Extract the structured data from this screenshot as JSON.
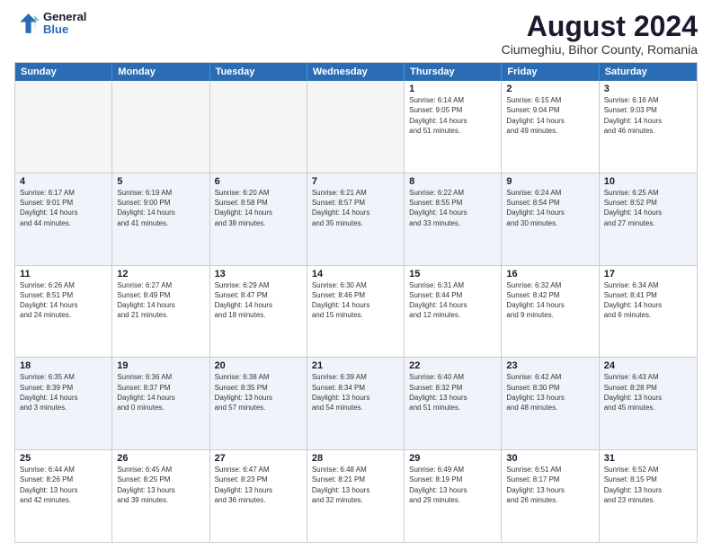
{
  "header": {
    "logo_line1": "General",
    "logo_line2": "Blue",
    "main_title": "August 2024",
    "subtitle": "Ciumeghiu, Bihor County, Romania"
  },
  "weekdays": [
    "Sunday",
    "Monday",
    "Tuesday",
    "Wednesday",
    "Thursday",
    "Friday",
    "Saturday"
  ],
  "rows": [
    [
      {
        "day": "",
        "info": "",
        "empty": true
      },
      {
        "day": "",
        "info": "",
        "empty": true
      },
      {
        "day": "",
        "info": "",
        "empty": true
      },
      {
        "day": "",
        "info": "",
        "empty": true
      },
      {
        "day": "1",
        "info": "Sunrise: 6:14 AM\nSunset: 9:05 PM\nDaylight: 14 hours\nand 51 minutes."
      },
      {
        "day": "2",
        "info": "Sunrise: 6:15 AM\nSunset: 9:04 PM\nDaylight: 14 hours\nand 49 minutes."
      },
      {
        "day": "3",
        "info": "Sunrise: 6:16 AM\nSunset: 9:03 PM\nDaylight: 14 hours\nand 46 minutes."
      }
    ],
    [
      {
        "day": "4",
        "info": "Sunrise: 6:17 AM\nSunset: 9:01 PM\nDaylight: 14 hours\nand 44 minutes."
      },
      {
        "day": "5",
        "info": "Sunrise: 6:19 AM\nSunset: 9:00 PM\nDaylight: 14 hours\nand 41 minutes."
      },
      {
        "day": "6",
        "info": "Sunrise: 6:20 AM\nSunset: 8:58 PM\nDaylight: 14 hours\nand 38 minutes."
      },
      {
        "day": "7",
        "info": "Sunrise: 6:21 AM\nSunset: 8:57 PM\nDaylight: 14 hours\nand 35 minutes."
      },
      {
        "day": "8",
        "info": "Sunrise: 6:22 AM\nSunset: 8:55 PM\nDaylight: 14 hours\nand 33 minutes."
      },
      {
        "day": "9",
        "info": "Sunrise: 6:24 AM\nSunset: 8:54 PM\nDaylight: 14 hours\nand 30 minutes."
      },
      {
        "day": "10",
        "info": "Sunrise: 6:25 AM\nSunset: 8:52 PM\nDaylight: 14 hours\nand 27 minutes."
      }
    ],
    [
      {
        "day": "11",
        "info": "Sunrise: 6:26 AM\nSunset: 8:51 PM\nDaylight: 14 hours\nand 24 minutes."
      },
      {
        "day": "12",
        "info": "Sunrise: 6:27 AM\nSunset: 8:49 PM\nDaylight: 14 hours\nand 21 minutes."
      },
      {
        "day": "13",
        "info": "Sunrise: 6:29 AM\nSunset: 8:47 PM\nDaylight: 14 hours\nand 18 minutes."
      },
      {
        "day": "14",
        "info": "Sunrise: 6:30 AM\nSunset: 8:46 PM\nDaylight: 14 hours\nand 15 minutes."
      },
      {
        "day": "15",
        "info": "Sunrise: 6:31 AM\nSunset: 8:44 PM\nDaylight: 14 hours\nand 12 minutes."
      },
      {
        "day": "16",
        "info": "Sunrise: 6:32 AM\nSunset: 8:42 PM\nDaylight: 14 hours\nand 9 minutes."
      },
      {
        "day": "17",
        "info": "Sunrise: 6:34 AM\nSunset: 8:41 PM\nDaylight: 14 hours\nand 6 minutes."
      }
    ],
    [
      {
        "day": "18",
        "info": "Sunrise: 6:35 AM\nSunset: 8:39 PM\nDaylight: 14 hours\nand 3 minutes."
      },
      {
        "day": "19",
        "info": "Sunrise: 6:36 AM\nSunset: 8:37 PM\nDaylight: 14 hours\nand 0 minutes."
      },
      {
        "day": "20",
        "info": "Sunrise: 6:38 AM\nSunset: 8:35 PM\nDaylight: 13 hours\nand 57 minutes."
      },
      {
        "day": "21",
        "info": "Sunrise: 6:39 AM\nSunset: 8:34 PM\nDaylight: 13 hours\nand 54 minutes."
      },
      {
        "day": "22",
        "info": "Sunrise: 6:40 AM\nSunset: 8:32 PM\nDaylight: 13 hours\nand 51 minutes."
      },
      {
        "day": "23",
        "info": "Sunrise: 6:42 AM\nSunset: 8:30 PM\nDaylight: 13 hours\nand 48 minutes."
      },
      {
        "day": "24",
        "info": "Sunrise: 6:43 AM\nSunset: 8:28 PM\nDaylight: 13 hours\nand 45 minutes."
      }
    ],
    [
      {
        "day": "25",
        "info": "Sunrise: 6:44 AM\nSunset: 8:26 PM\nDaylight: 13 hours\nand 42 minutes."
      },
      {
        "day": "26",
        "info": "Sunrise: 6:45 AM\nSunset: 8:25 PM\nDaylight: 13 hours\nand 39 minutes."
      },
      {
        "day": "27",
        "info": "Sunrise: 6:47 AM\nSunset: 8:23 PM\nDaylight: 13 hours\nand 36 minutes."
      },
      {
        "day": "28",
        "info": "Sunrise: 6:48 AM\nSunset: 8:21 PM\nDaylight: 13 hours\nand 32 minutes."
      },
      {
        "day": "29",
        "info": "Sunrise: 6:49 AM\nSunset: 8:19 PM\nDaylight: 13 hours\nand 29 minutes."
      },
      {
        "day": "30",
        "info": "Sunrise: 6:51 AM\nSunset: 8:17 PM\nDaylight: 13 hours\nand 26 minutes."
      },
      {
        "day": "31",
        "info": "Sunrise: 6:52 AM\nSunset: 8:15 PM\nDaylight: 13 hours\nand 23 minutes."
      }
    ]
  ]
}
